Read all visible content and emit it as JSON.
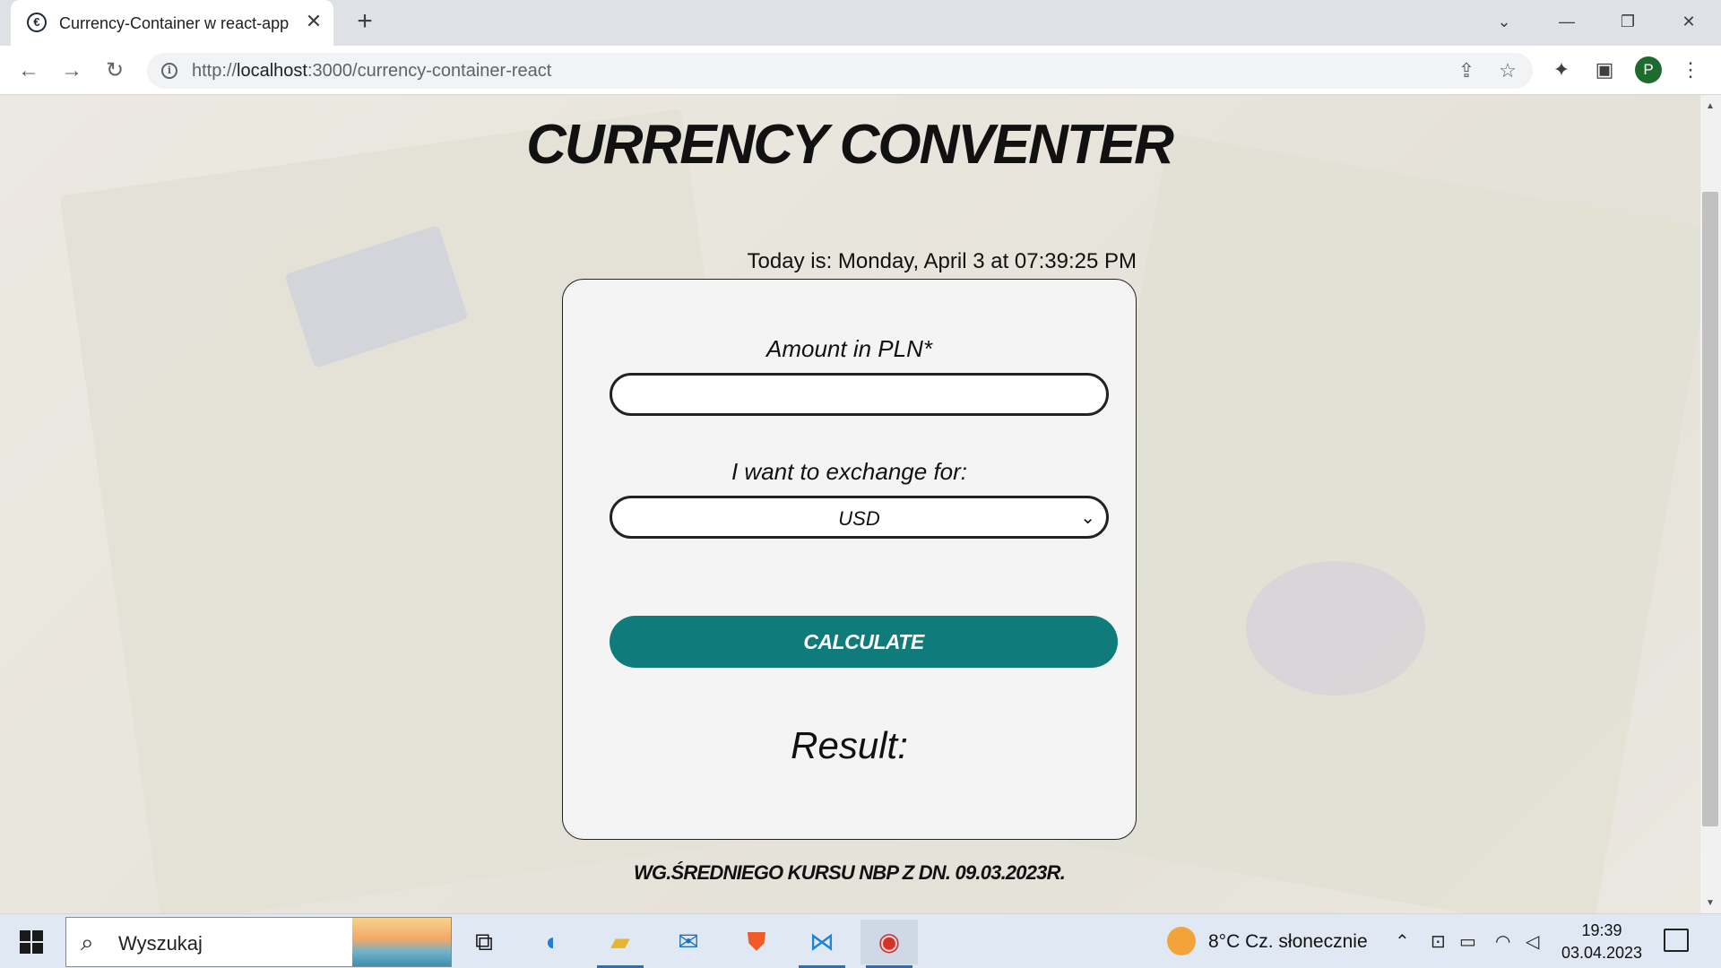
{
  "browser": {
    "tab_title": "Currency-Container w react-app",
    "url_prefix": "http://",
    "url_host": "localhost",
    "url_path": ":3000/currency-container-react",
    "profile_initial": "P"
  },
  "app": {
    "heading": "CURRENCY CONVENTER",
    "today": "Today is: Monday, April 3 at 07:39:25 PM",
    "amount_label": "Amount in PLN*",
    "amount_value": "",
    "exchange_label": "I want to exchange for:",
    "selected_currency": "USD",
    "calculate_label": "CALCULATE",
    "result_label": "Result:",
    "footnote": "WG.ŚREDNIEGO KURSU NBP Z DN. 09.03.2023R.",
    "accent_color": "#0f7b7b"
  },
  "taskbar": {
    "search_placeholder": "Wyszukaj",
    "weather": "8°C  Cz. słonecznie",
    "time": "19:39",
    "date": "03.04.2023"
  }
}
